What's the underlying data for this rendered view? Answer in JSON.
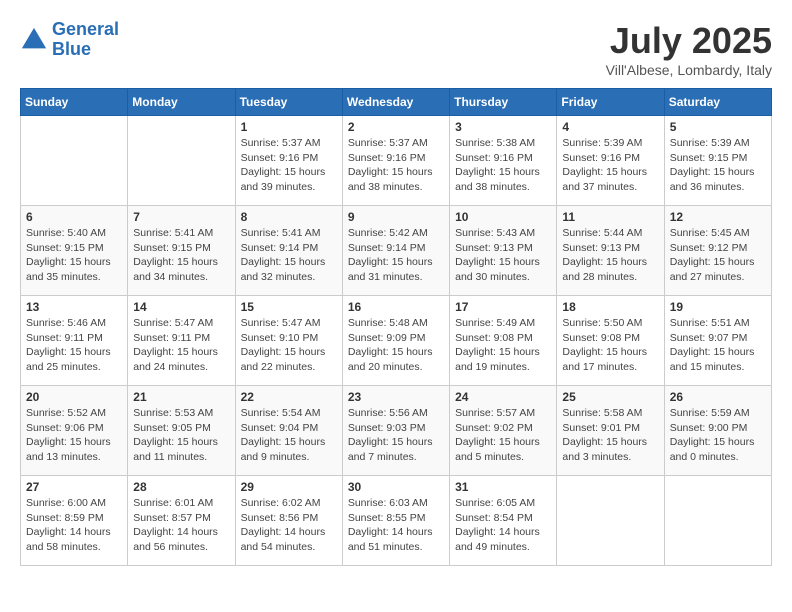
{
  "header": {
    "logo_line1": "General",
    "logo_line2": "Blue",
    "month": "July 2025",
    "location": "Vill'Albese, Lombardy, Italy"
  },
  "weekdays": [
    "Sunday",
    "Monday",
    "Tuesday",
    "Wednesday",
    "Thursday",
    "Friday",
    "Saturday"
  ],
  "weeks": [
    [
      {
        "day": "",
        "info": ""
      },
      {
        "day": "",
        "info": ""
      },
      {
        "day": "1",
        "info": "Sunrise: 5:37 AM\nSunset: 9:16 PM\nDaylight: 15 hours\nand 39 minutes."
      },
      {
        "day": "2",
        "info": "Sunrise: 5:37 AM\nSunset: 9:16 PM\nDaylight: 15 hours\nand 38 minutes."
      },
      {
        "day": "3",
        "info": "Sunrise: 5:38 AM\nSunset: 9:16 PM\nDaylight: 15 hours\nand 38 minutes."
      },
      {
        "day": "4",
        "info": "Sunrise: 5:39 AM\nSunset: 9:16 PM\nDaylight: 15 hours\nand 37 minutes."
      },
      {
        "day": "5",
        "info": "Sunrise: 5:39 AM\nSunset: 9:15 PM\nDaylight: 15 hours\nand 36 minutes."
      }
    ],
    [
      {
        "day": "6",
        "info": "Sunrise: 5:40 AM\nSunset: 9:15 PM\nDaylight: 15 hours\nand 35 minutes."
      },
      {
        "day": "7",
        "info": "Sunrise: 5:41 AM\nSunset: 9:15 PM\nDaylight: 15 hours\nand 34 minutes."
      },
      {
        "day": "8",
        "info": "Sunrise: 5:41 AM\nSunset: 9:14 PM\nDaylight: 15 hours\nand 32 minutes."
      },
      {
        "day": "9",
        "info": "Sunrise: 5:42 AM\nSunset: 9:14 PM\nDaylight: 15 hours\nand 31 minutes."
      },
      {
        "day": "10",
        "info": "Sunrise: 5:43 AM\nSunset: 9:13 PM\nDaylight: 15 hours\nand 30 minutes."
      },
      {
        "day": "11",
        "info": "Sunrise: 5:44 AM\nSunset: 9:13 PM\nDaylight: 15 hours\nand 28 minutes."
      },
      {
        "day": "12",
        "info": "Sunrise: 5:45 AM\nSunset: 9:12 PM\nDaylight: 15 hours\nand 27 minutes."
      }
    ],
    [
      {
        "day": "13",
        "info": "Sunrise: 5:46 AM\nSunset: 9:11 PM\nDaylight: 15 hours\nand 25 minutes."
      },
      {
        "day": "14",
        "info": "Sunrise: 5:47 AM\nSunset: 9:11 PM\nDaylight: 15 hours\nand 24 minutes."
      },
      {
        "day": "15",
        "info": "Sunrise: 5:47 AM\nSunset: 9:10 PM\nDaylight: 15 hours\nand 22 minutes."
      },
      {
        "day": "16",
        "info": "Sunrise: 5:48 AM\nSunset: 9:09 PM\nDaylight: 15 hours\nand 20 minutes."
      },
      {
        "day": "17",
        "info": "Sunrise: 5:49 AM\nSunset: 9:08 PM\nDaylight: 15 hours\nand 19 minutes."
      },
      {
        "day": "18",
        "info": "Sunrise: 5:50 AM\nSunset: 9:08 PM\nDaylight: 15 hours\nand 17 minutes."
      },
      {
        "day": "19",
        "info": "Sunrise: 5:51 AM\nSunset: 9:07 PM\nDaylight: 15 hours\nand 15 minutes."
      }
    ],
    [
      {
        "day": "20",
        "info": "Sunrise: 5:52 AM\nSunset: 9:06 PM\nDaylight: 15 hours\nand 13 minutes."
      },
      {
        "day": "21",
        "info": "Sunrise: 5:53 AM\nSunset: 9:05 PM\nDaylight: 15 hours\nand 11 minutes."
      },
      {
        "day": "22",
        "info": "Sunrise: 5:54 AM\nSunset: 9:04 PM\nDaylight: 15 hours\nand 9 minutes."
      },
      {
        "day": "23",
        "info": "Sunrise: 5:56 AM\nSunset: 9:03 PM\nDaylight: 15 hours\nand 7 minutes."
      },
      {
        "day": "24",
        "info": "Sunrise: 5:57 AM\nSunset: 9:02 PM\nDaylight: 15 hours\nand 5 minutes."
      },
      {
        "day": "25",
        "info": "Sunrise: 5:58 AM\nSunset: 9:01 PM\nDaylight: 15 hours\nand 3 minutes."
      },
      {
        "day": "26",
        "info": "Sunrise: 5:59 AM\nSunset: 9:00 PM\nDaylight: 15 hours\nand 0 minutes."
      }
    ],
    [
      {
        "day": "27",
        "info": "Sunrise: 6:00 AM\nSunset: 8:59 PM\nDaylight: 14 hours\nand 58 minutes."
      },
      {
        "day": "28",
        "info": "Sunrise: 6:01 AM\nSunset: 8:57 PM\nDaylight: 14 hours\nand 56 minutes."
      },
      {
        "day": "29",
        "info": "Sunrise: 6:02 AM\nSunset: 8:56 PM\nDaylight: 14 hours\nand 54 minutes."
      },
      {
        "day": "30",
        "info": "Sunrise: 6:03 AM\nSunset: 8:55 PM\nDaylight: 14 hours\nand 51 minutes."
      },
      {
        "day": "31",
        "info": "Sunrise: 6:05 AM\nSunset: 8:54 PM\nDaylight: 14 hours\nand 49 minutes."
      },
      {
        "day": "",
        "info": ""
      },
      {
        "day": "",
        "info": ""
      }
    ]
  ]
}
